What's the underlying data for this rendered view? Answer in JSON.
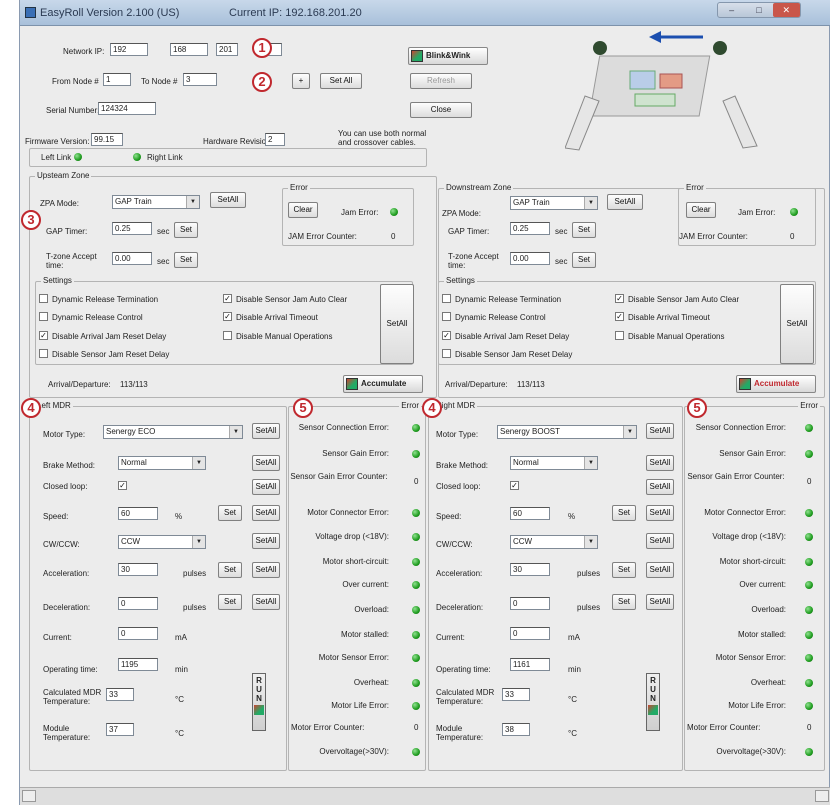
{
  "window": {
    "title": "EasyRoll Version 2.100 (US)",
    "current_ip": "Current IP: 192.168.201.20"
  },
  "titlebar_buttons": {
    "min": "–",
    "max": "□",
    "close": "✕"
  },
  "top": {
    "network_ip_label": "Network IP:",
    "ip1": "192",
    "ip2": "168",
    "ip3": "201",
    "ip4": "",
    "from_node_label": "From Node #",
    "from_node": "1",
    "to_node_label": "To Node #",
    "to_node": "3",
    "plus_label": "+",
    "set_all_label": "Set All",
    "serial_label": "Serial Number:",
    "serial": "124324",
    "firmware_label": "Firmware Version:",
    "firmware": "99.15",
    "hardware_label": "Hardware Revision:",
    "hardware": "2",
    "cable_note": "You can use both normal and crossover cables.",
    "blink_label": "Blink&Wink",
    "refresh_label": "Refresh",
    "close_label": "Close",
    "left_link": "Left Link",
    "right_link": "Right Link"
  },
  "badges": {
    "b1": "1",
    "b2": "2",
    "b3": "3",
    "b4": "4",
    "b5": "5"
  },
  "upstream": {
    "title": "Upsteam Zone",
    "zpa_label": "ZPA Mode:",
    "zpa_value": "GAP Train",
    "setall": "SetAll",
    "gap_label": "GAP Timer:",
    "gap_value": "0.25",
    "sec": "sec",
    "set": "Set",
    "tzone_label": "T-zone Accept time:",
    "tzone_value": "0.00",
    "error_title": "Error",
    "clear": "Clear",
    "jam_error": "Jam Error:",
    "jam_counter": "JAM Error Counter:",
    "jam_counter_value": "0",
    "settings_title": "Settings",
    "opt1": "Dynamic Release Termination",
    "opt2": "Dynamic Release Control",
    "opt3": "Disable Arrival Jam Reset Delay",
    "opt4": "Disable Sensor Jam Reset Delay",
    "opt5": "Disable Sensor Jam Auto Clear",
    "opt6": "Disable Arrival Timeout",
    "opt7": "Disable Manual Operations",
    "arrival_label": "Arrival/Departure:",
    "arrival_value": "113/113",
    "accumulate": "Accumulate"
  },
  "downstream": {
    "title": "Downstream Zone",
    "zpa_label": "ZPA Mode:",
    "zpa_value": "GAP Train",
    "setall": "SetAll",
    "gap_label": "GAP Timer:",
    "gap_value": "0.25",
    "sec": "sec",
    "set": "Set",
    "tzone_label": "T-zone Accept time:",
    "tzone_value": "0.00",
    "error_title": "Error",
    "clear": "Clear",
    "jam_error": "Jam Error:",
    "jam_counter": "JAM Error Counter:",
    "jam_counter_value": "0",
    "settings_title": "Settings",
    "opt1": "Dynamic Release Termination",
    "opt2": "Dynamic Release Control",
    "opt3": "Disable Arrival Jam Reset Delay",
    "opt4": "Disable Sensor Jam Reset Delay",
    "opt5": "Disable Sensor Jam Auto Clear",
    "opt6": "Disable Arrival Timeout",
    "opt7": "Disable Manual Operations",
    "arrival_label": "Arrival/Departure:",
    "arrival_value": "113/113",
    "accumulate": "Accumulate"
  },
  "left_mdr": {
    "title": "Left MDR",
    "motor_label": "Motor Type:",
    "motor_value": "Senergy ECO",
    "brake_label": "Brake Method:",
    "brake_value": "Normal",
    "closed_label": "Closed loop:",
    "speed_label": "Speed:",
    "speed_value": "60",
    "speed_unit": "%",
    "cw_label": "CW/CCW:",
    "cw_value": "CCW",
    "acc_label": "Acceleration:",
    "acc_value": "30",
    "dec_label": "Deceleration:",
    "dec_value": "0",
    "pulse_unit": "pulses",
    "current_label": "Current:",
    "current_value": "0",
    "current_unit": "mA",
    "optime_label": "Operating time:",
    "optime_value": "1195",
    "optime_unit": "min",
    "calc_label": "Calculated MDR Temperature:",
    "calc_value": "33",
    "temp_unit": "°C",
    "module_label": "Module Temperature:",
    "module_value": "37",
    "set": "Set",
    "setall": "SetAll",
    "run": "RUN"
  },
  "right_mdr": {
    "title": "Right MDR",
    "motor_label": "Motor Type:",
    "motor_value": "Senergy BOOST",
    "brake_label": "Brake Method:",
    "brake_value": "Normal",
    "closed_label": "Closed loop:",
    "speed_label": "Speed:",
    "speed_value": "60",
    "speed_unit": "%",
    "cw_label": "CW/CCW:",
    "cw_value": "CCW",
    "acc_label": "Acceleration:",
    "acc_value": "30",
    "dec_label": "Deceleration:",
    "dec_value": "0",
    "pulse_unit": "pulses",
    "current_label": "Current:",
    "current_value": "0",
    "current_unit": "mA",
    "optime_label": "Operating time:",
    "optime_value": "1161",
    "optime_unit": "min",
    "calc_label": "Calculated MDR Temperature:",
    "calc_value": "33",
    "temp_unit": "°C",
    "module_label": "Module Temperature:",
    "module_value": "38",
    "set": "Set",
    "setall": "SetAll",
    "run": "RUN"
  },
  "errors_left": {
    "title": "Error",
    "e1": "Sensor Connection Error:",
    "e2": "Sensor Gain Error:",
    "e3": "Sensor Gain Error Counter:",
    "e3v": "0",
    "e4": "Motor Connector Error:",
    "e5": "Voltage drop (<18V):",
    "e6": "Motor short-circuit:",
    "e7": "Over current:",
    "e8": "Overload:",
    "e9": "Motor stalled:",
    "e10": "Motor Sensor Error:",
    "e11": "Overheat:",
    "e12": "Motor Life Error:",
    "e13": "Motor Error Counter:",
    "e13v": "0",
    "e14": "Overvoltage(>30V):"
  },
  "errors_right": {
    "title": "Error",
    "e1": "Sensor Connection Error:",
    "e2": "Sensor Gain Error:",
    "e3": "Sensor Gain Error Counter:",
    "e3v": "0",
    "e4": "Motor Connector Error:",
    "e5": "Voltage drop (<18V):",
    "e6": "Motor short-circuit:",
    "e7": "Over current:",
    "e8": "Overload:",
    "e9": "Motor stalled:",
    "e10": "Motor Sensor Error:",
    "e11": "Overheat:",
    "e12": "Motor Life Error:",
    "e13": "Motor Error Counter:",
    "e13v": "0",
    "e14": "Overvoltage(>30V):"
  },
  "colors": {
    "badge": "#c0282e",
    "led": "#1f9d1f",
    "arrow": "#1c4fb0"
  }
}
